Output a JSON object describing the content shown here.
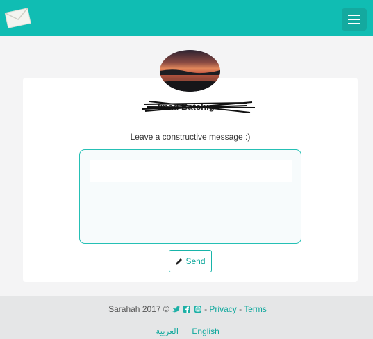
{
  "header": {
    "logo_icon": "envelope-icon",
    "menu_icon": "hamburger-menu-icon"
  },
  "profile": {
    "name": "Imad Batchig",
    "name_state": "scribbled-out"
  },
  "form": {
    "prompt": "Leave a constructive message :)",
    "message_value": "",
    "send_label": "Send",
    "send_icon": "pencil-icon"
  },
  "footer": {
    "copyright": "Sarahah 2017 ©",
    "social_icons": [
      "twitter-icon",
      "facebook-icon",
      "instagram-icon"
    ],
    "separator": "-",
    "privacy": "Privacy",
    "terms": "Terms",
    "languages": [
      "العربية",
      "English"
    ]
  },
  "colors": {
    "brand": "#10bdb3",
    "accent_text": "#10a89d",
    "footer_bg": "#e5e6e7"
  }
}
